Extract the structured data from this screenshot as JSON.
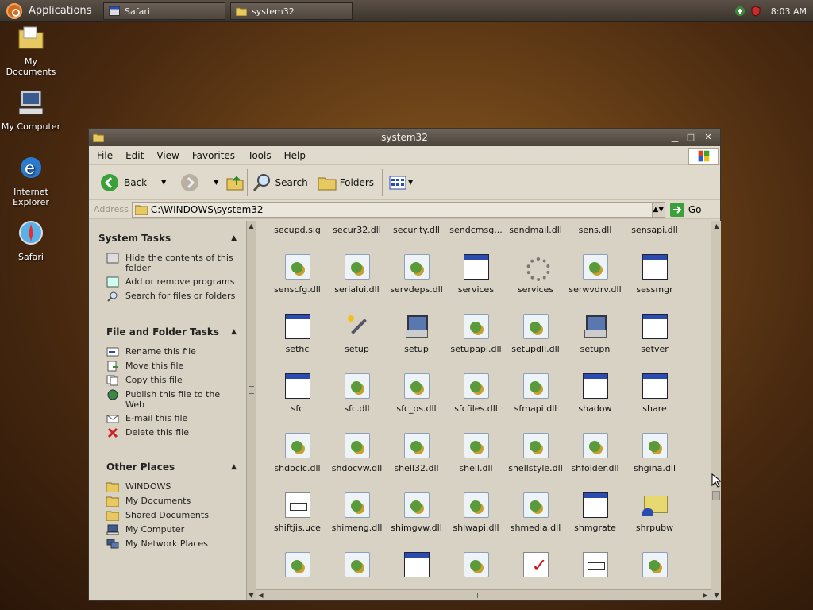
{
  "top_panel": {
    "applications_label": "Applications",
    "tasks": [
      {
        "label": "Safari"
      },
      {
        "label": "system32"
      }
    ],
    "clock": "8:03 AM"
  },
  "desktop_icons": [
    {
      "label": "My Documents"
    },
    {
      "label": "My Computer"
    },
    {
      "label": "Internet Explorer"
    },
    {
      "label": "Safari"
    }
  ],
  "window": {
    "title": "system32",
    "menu": [
      "File",
      "Edit",
      "View",
      "Favorites",
      "Tools",
      "Help"
    ],
    "toolbar": {
      "back": "Back",
      "search": "Search",
      "folders": "Folders"
    },
    "address": {
      "label": "Address",
      "value": "C:\\WINDOWS\\system32",
      "go": "Go"
    }
  },
  "left_pane": {
    "system_tasks": {
      "title": "System Tasks",
      "items": [
        "Hide the contents of this folder",
        "Add or remove programs",
        "Search for files or folders"
      ]
    },
    "file_tasks": {
      "title": "File and Folder Tasks",
      "items": [
        "Rename this file",
        "Move this file",
        "Copy this file",
        "Publish this file to the Web",
        "E-mail this file",
        "Delete this file"
      ]
    },
    "other_places": {
      "title": "Other Places",
      "items": [
        "WINDOWS",
        "My Documents",
        "Shared Documents",
        "My Computer",
        "My Network Places"
      ]
    }
  },
  "files": [
    {
      "name": "secupd.sig",
      "icon": "doc-icon"
    },
    {
      "name": "secur32.dll",
      "icon": "dll-icon"
    },
    {
      "name": "security.dll",
      "icon": "dll-icon"
    },
    {
      "name": "sendcmsg...",
      "icon": "dll-icon"
    },
    {
      "name": "sendmail.dll",
      "icon": "dll-icon"
    },
    {
      "name": "sens.dll",
      "icon": "dll-icon"
    },
    {
      "name": "sensapi.dll",
      "icon": "dll-icon"
    },
    {
      "name": "senscfg.dll",
      "icon": "dll-icon"
    },
    {
      "name": "serialui.dll",
      "icon": "dll-icon"
    },
    {
      "name": "servdeps.dll",
      "icon": "dll-icon"
    },
    {
      "name": "services",
      "icon": "exe-icon"
    },
    {
      "name": "services",
      "icon": "cmd-icon"
    },
    {
      "name": "serwvdrv.dll",
      "icon": "dll-icon"
    },
    {
      "name": "sessmgr",
      "icon": "exe-icon"
    },
    {
      "name": "sethc",
      "icon": "exe-icon"
    },
    {
      "name": "setup",
      "icon": "wand-icon"
    },
    {
      "name": "setup",
      "icon": "pc-icon"
    },
    {
      "name": "setupapi.dll",
      "icon": "dll-icon"
    },
    {
      "name": "setupdll.dll",
      "icon": "dll-icon"
    },
    {
      "name": "setupn",
      "icon": "pc-icon"
    },
    {
      "name": "setver",
      "icon": "exe-icon"
    },
    {
      "name": "sfc",
      "icon": "exe-icon"
    },
    {
      "name": "sfc.dll",
      "icon": "dll-icon"
    },
    {
      "name": "sfc_os.dll",
      "icon": "dll-icon"
    },
    {
      "name": "sfcfiles.dll",
      "icon": "dll-icon"
    },
    {
      "name": "sfmapi.dll",
      "icon": "dll-icon"
    },
    {
      "name": "shadow",
      "icon": "exe-icon"
    },
    {
      "name": "share",
      "icon": "exe-icon"
    },
    {
      "name": "shdoclc.dll",
      "icon": "dll-icon"
    },
    {
      "name": "shdocvw.dll",
      "icon": "dll-icon"
    },
    {
      "name": "shell32.dll",
      "icon": "dll-icon"
    },
    {
      "name": "shell.dll",
      "icon": "dll-icon"
    },
    {
      "name": "shellstyle.dll",
      "icon": "dll-icon"
    },
    {
      "name": "shfolder.dll",
      "icon": "dll-icon"
    },
    {
      "name": "shgina.dll",
      "icon": "dll-icon"
    },
    {
      "name": "shiftjis.uce",
      "icon": "doc-icon"
    },
    {
      "name": "shimeng.dll",
      "icon": "dll-icon"
    },
    {
      "name": "shimgvw.dll",
      "icon": "dll-icon"
    },
    {
      "name": "shlwapi.dll",
      "icon": "dll-icon"
    },
    {
      "name": "shmedia.dll",
      "icon": "dll-icon"
    },
    {
      "name": "shmgrate",
      "icon": "exe-icon"
    },
    {
      "name": "shrpubw",
      "icon": "share-icon"
    },
    {
      "name": "",
      "icon": "dll-icon"
    },
    {
      "name": "",
      "icon": "dll-icon"
    },
    {
      "name": "",
      "icon": "exe-icon"
    },
    {
      "name": "",
      "icon": "dll-icon"
    },
    {
      "name": "",
      "icon": "check-icon"
    },
    {
      "name": "",
      "icon": "doc-icon"
    },
    {
      "name": "",
      "icon": "dll-icon"
    }
  ]
}
